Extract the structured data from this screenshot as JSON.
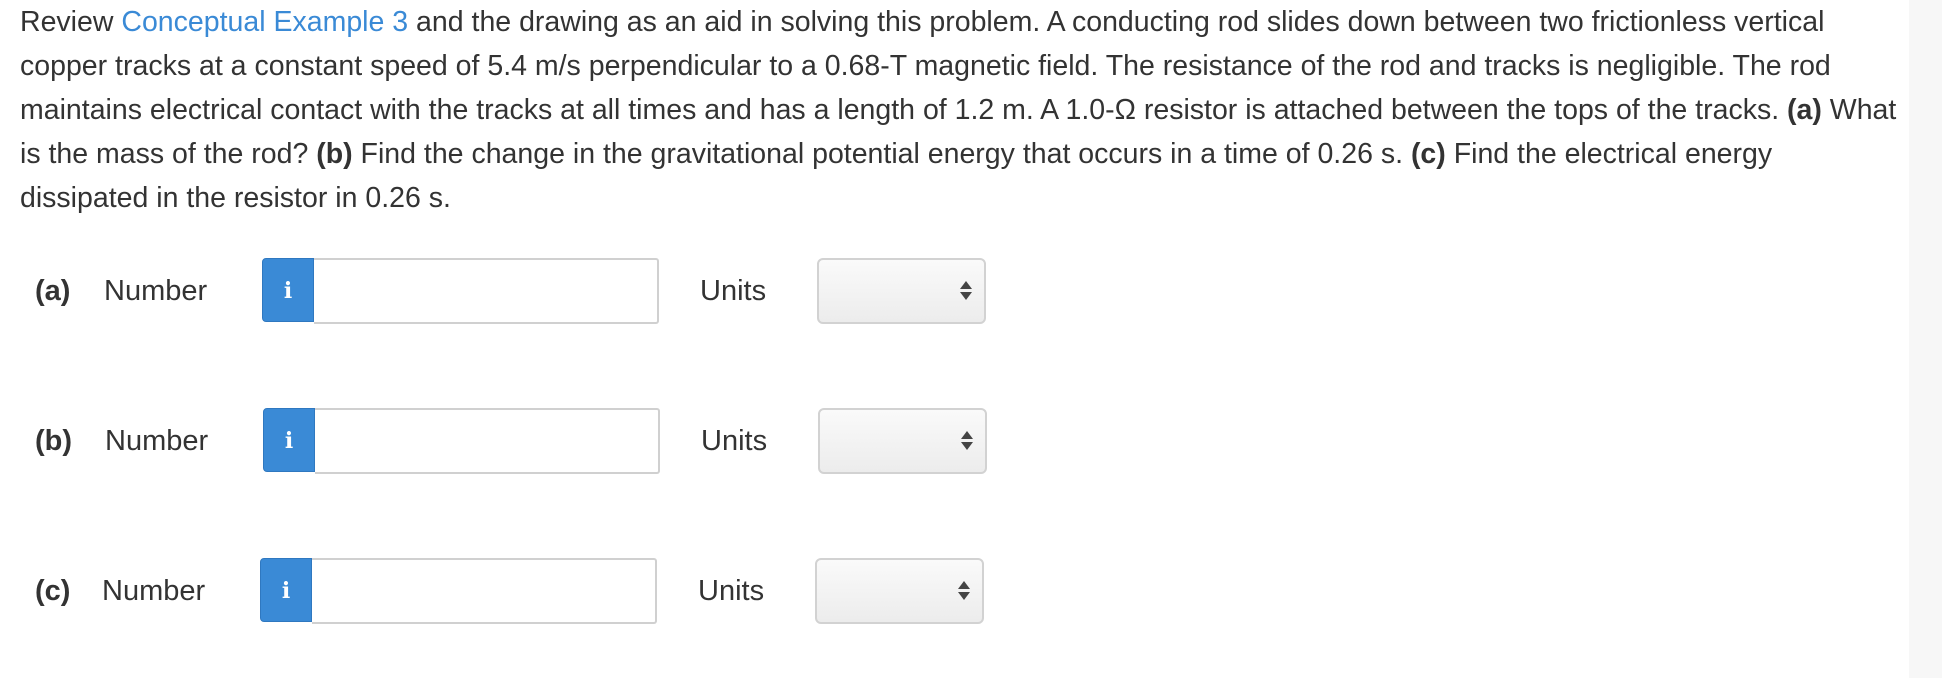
{
  "question": {
    "prefix": "Review ",
    "link_text": "Conceptual Example 3",
    "text1": " and the drawing as an aid in solving this problem. A conducting rod slides down between two frictionless vertical copper tracks at a constant speed of 5.4 m/s perpendicular to a 0.68-T magnetic field. The resistance of the rod and tracks is negligible. The rod maintains electrical contact with the tracks at all times and has a length of 1.2 m. A 1.0-Ω resistor is attached between the tops of the tracks. ",
    "part_a_label": "(a)",
    "part_a_text": " What is the mass of the rod? ",
    "part_b_label": "(b)",
    "part_b_text": " Find the change in the gravitational potential energy that occurs in a time of 0.26 s. ",
    "part_c_label": "(c)",
    "part_c_text": " Find the electrical energy dissipated in the resistor in 0.26 s."
  },
  "answers": [
    {
      "part": "(a)",
      "number_label": "Number",
      "info_icon": "i",
      "value": "",
      "units_label": "Units",
      "units_value": ""
    },
    {
      "part": "(b)",
      "number_label": "Number",
      "info_icon": "i",
      "value": "",
      "units_label": "Units",
      "units_value": ""
    },
    {
      "part": "(c)",
      "number_label": "Number",
      "info_icon": "i",
      "value": "",
      "units_label": "Units",
      "units_value": ""
    }
  ],
  "colors": {
    "link": "#3a8ad6",
    "info_button": "#3a8ad6",
    "text": "#333333"
  }
}
